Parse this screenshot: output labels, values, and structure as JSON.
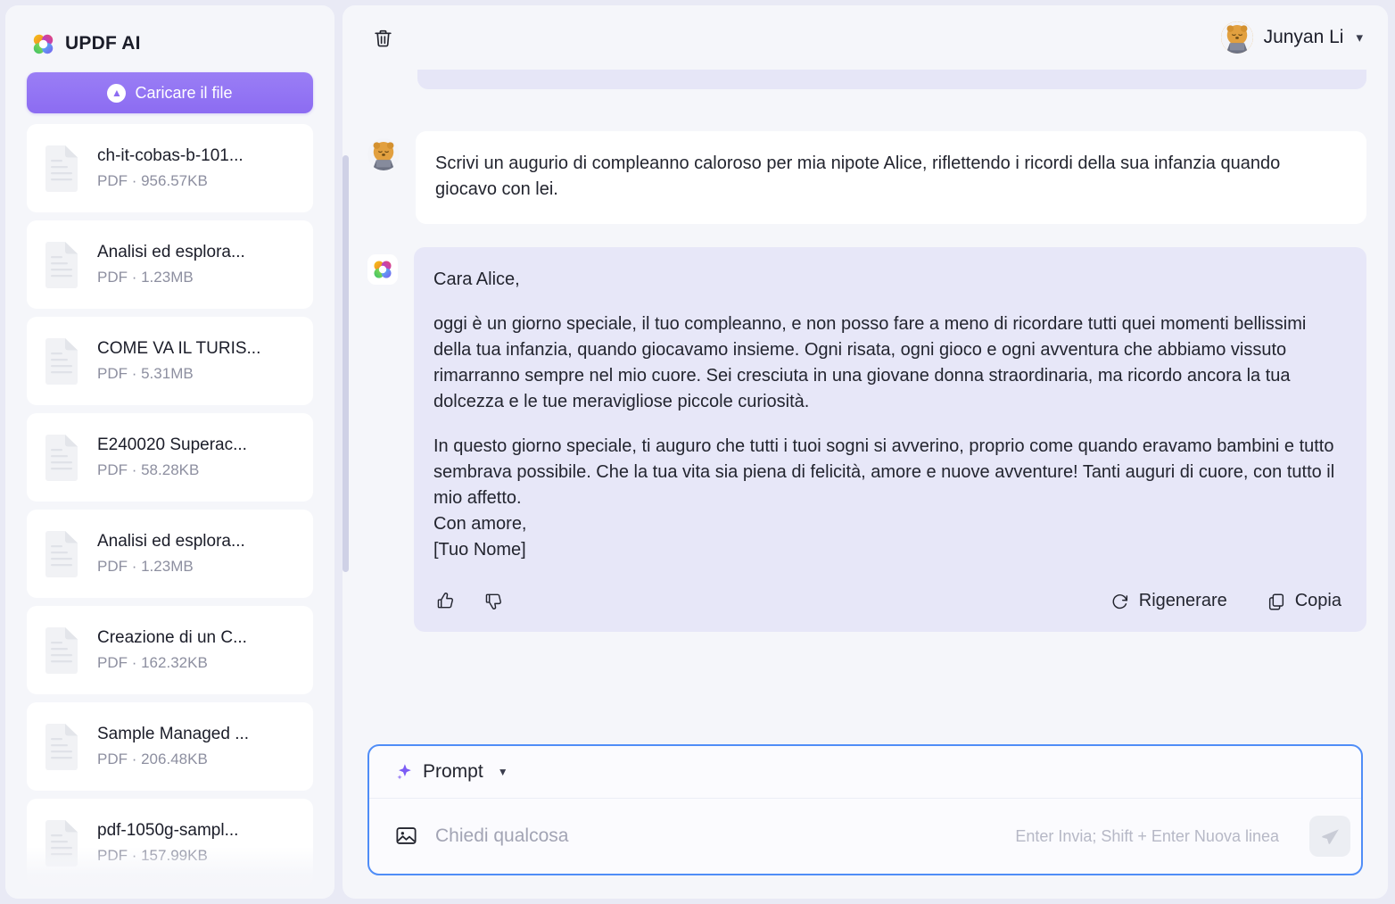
{
  "sidebar": {
    "brand": "UPDF AI",
    "brand_logo_icon": "updf-flower-logo",
    "upload_button": "Caricare il file",
    "upload_icon": "upload-circle-icon",
    "files": [
      {
        "name": "ch-it-cobas-b-101...",
        "meta": "PDF · 956.57KB"
      },
      {
        "name": "Analisi ed esplora...",
        "meta": "PDF · 1.23MB"
      },
      {
        "name": "COME VA IL TURIS...",
        "meta": "PDF · 5.31MB"
      },
      {
        "name": "E240020 Superac...",
        "meta": "PDF · 58.28KB"
      },
      {
        "name": "Analisi ed esplora...",
        "meta": "PDF · 1.23MB"
      },
      {
        "name": "Creazione di un C...",
        "meta": "PDF · 162.32KB"
      },
      {
        "name": "Sample Managed ...",
        "meta": "PDF · 206.48KB"
      },
      {
        "name": "pdf-1050g-sampl...",
        "meta": "PDF · 157.99KB"
      }
    ]
  },
  "topbar": {
    "trash_icon": "trash-icon",
    "user_name": "Junyan Li",
    "caret_icon": "chevron-down-icon",
    "avatar_icon": "user-avatar"
  },
  "chat": {
    "user_message": "Scrivi un augurio di compleanno caloroso per mia nipote Alice, riflettendo i ricordi della sua infanzia quando giocavo con lei.",
    "ai_message": {
      "greeting": "Cara Alice,",
      "paragraph1": "oggi è un giorno speciale, il tuo compleanno, e non posso fare a meno di ricordare tutti quei momenti bellissimi della tua infanzia, quando giocavamo insieme. Ogni risata, ogni gioco e ogni avventura che abbiamo vissuto rimarranno sempre nel mio cuore. Sei cresciuta in una giovane donna straordinaria, ma ricordo ancora la tua dolcezza e le tue meravigliose piccole curiosità.",
      "paragraph2": "In questo giorno speciale, ti auguro che tutti i tuoi sogni si avverino, proprio come quando eravamo bambini e tutto sembrava possibile. Che la tua vita sia piena di felicità, amore e nuove avventure! Tanti auguri di cuore, con tutto il mio affetto.",
      "closing1": "Con amore,",
      "closing2": "[Tuo Nome]"
    },
    "actions": {
      "thumbs_up_icon": "thumbs-up-icon",
      "thumbs_down_icon": "thumbs-down-icon",
      "regenerate": "Rigenerare",
      "regenerate_icon": "refresh-icon",
      "copy": "Copia",
      "copy_icon": "copy-icon"
    }
  },
  "composer": {
    "mode_label": "Prompt",
    "mode_icon": "sparkle-icon",
    "mode_caret_icon": "caret-down-icon",
    "image_icon": "image-icon",
    "input_value": "",
    "placeholder": "Chiedi qualcosa",
    "hint": "Enter Invia; Shift + Enter Nuova linea",
    "send_icon": "send-plane-icon"
  },
  "colors": {
    "accent_purple": "#8c6cf2",
    "ai_bubble": "#e7e7f8",
    "focus_border": "#4f8df7",
    "page_bg": "#e9eaf5",
    "panel_bg": "#f5f6fa"
  }
}
